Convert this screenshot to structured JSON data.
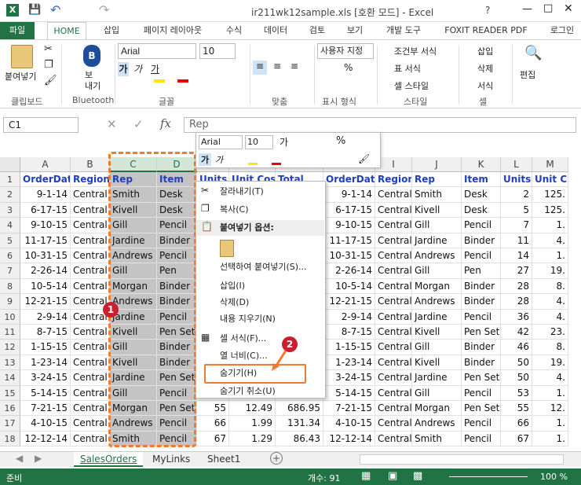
{
  "window": {
    "title": "ir211wk12sample.xls  [호환 모드] - Excel",
    "help": "?"
  },
  "tabs": [
    "파일",
    "HOME",
    "삽입",
    "페이지 레이아웃",
    "수식",
    "데이터",
    "검토",
    "보기",
    "개발 도구",
    "FOXIT READER PDF",
    "로그인"
  ],
  "ribbon": {
    "paste": "붙여넣기",
    "bluetooth": "보\n내기",
    "font_name": "Arial",
    "font_size": "10",
    "number_format": "사용자 지정",
    "cond_format": "조건부 서식",
    "table_format": "표 서식",
    "cell_style": "셀 스타일",
    "insert": "삽입",
    "delete": "삭제",
    "format": "서식",
    "edit": "편집",
    "groups": {
      "clipboard": "클립보드",
      "bluetooth": "Bluetooth",
      "font": "글꼴",
      "align": "맞춤",
      "number": "표시 형식",
      "style": "스타일",
      "cells": "셀"
    }
  },
  "formula": {
    "namebox": "C1",
    "value": "Rep",
    "fx": "fx"
  },
  "columns": [
    "A",
    "B",
    "C",
    "D",
    "E",
    "F",
    "G",
    "H",
    "I",
    "J",
    "K",
    "L",
    "M"
  ],
  "rows": [
    [
      "OrderDate",
      "Region",
      "Rep",
      "Item",
      "Units",
      "Unit Cost",
      "Total",
      "OrderDate",
      "Region",
      "Rep",
      "Item",
      "Units",
      "Unit C"
    ],
    [
      "9-1-14",
      "Central",
      "Smith",
      "Desk",
      "",
      "",
      "",
      "9-1-14",
      "Central",
      "Smith",
      "Desk",
      "2",
      "125."
    ],
    [
      "6-17-15",
      "Central",
      "Kivell",
      "Desk",
      "",
      "",
      "",
      "6-17-15",
      "Central",
      "Kivell",
      "Desk",
      "5",
      "125."
    ],
    [
      "9-10-15",
      "Central",
      "Gill",
      "Pencil",
      "",
      "",
      "",
      "9-10-15",
      "Central",
      "Gill",
      "Pencil",
      "7",
      "1."
    ],
    [
      "11-17-15",
      "Central",
      "Jardine",
      "Binder",
      "",
      "",
      "",
      "11-17-15",
      "Central",
      "Jardine",
      "Binder",
      "11",
      "4."
    ],
    [
      "10-31-15",
      "Central",
      "Andrews",
      "Pencil",
      "",
      "",
      "",
      "10-31-15",
      "Central",
      "Andrews",
      "Pencil",
      "14",
      "1."
    ],
    [
      "2-26-14",
      "Central",
      "Gill",
      "Pen",
      "",
      "",
      "",
      "2-26-14",
      "Central",
      "Gill",
      "Pen",
      "27",
      "19."
    ],
    [
      "10-5-14",
      "Central",
      "Morgan",
      "Binder",
      "",
      "",
      "",
      "10-5-14",
      "Central",
      "Morgan",
      "Binder",
      "28",
      "8."
    ],
    [
      "12-21-15",
      "Central",
      "Andrews",
      "Binder",
      "",
      "",
      "",
      "12-21-15",
      "Central",
      "Andrews",
      "Binder",
      "28",
      "4."
    ],
    [
      "2-9-14",
      "Central",
      "Jardine",
      "Pencil",
      "",
      "",
      "",
      "2-9-14",
      "Central",
      "Jardine",
      "Pencil",
      "36",
      "4."
    ],
    [
      "8-7-15",
      "Central",
      "Kivell",
      "Pen Set",
      "",
      "",
      "",
      "8-7-15",
      "Central",
      "Kivell",
      "Pen Set",
      "42",
      "23."
    ],
    [
      "1-15-15",
      "Central",
      "Gill",
      "Binder",
      "",
      "",
      "",
      "1-15-15",
      "Central",
      "Gill",
      "Binder",
      "46",
      "8."
    ],
    [
      "1-23-14",
      "Central",
      "Kivell",
      "Binder",
      "",
      "",
      "",
      "1-23-14",
      "Central",
      "Kivell",
      "Binder",
      "50",
      "19."
    ],
    [
      "3-24-15",
      "Central",
      "Jardine",
      "Pen Set",
      "",
      "",
      "",
      "3-24-15",
      "Central",
      "Jardine",
      "Pen Set",
      "50",
      "4."
    ],
    [
      "5-14-15",
      "Central",
      "Gill",
      "Pencil",
      "",
      "",
      "",
      "5-14-15",
      "Central",
      "Gill",
      "Pencil",
      "53",
      "1."
    ],
    [
      "7-21-15",
      "Central",
      "Morgan",
      "Pen Set",
      "55",
      "12.49",
      "686.95",
      "7-21-15",
      "Central",
      "Morgan",
      "Pen Set",
      "55",
      "12."
    ],
    [
      "4-10-15",
      "Central",
      "Andrews",
      "Pencil",
      "66",
      "1.99",
      "131.34",
      "4-10-15",
      "Central",
      "Andrews",
      "Pencil",
      "66",
      "1."
    ],
    [
      "12-12-14",
      "Central",
      "Smith",
      "Pencil",
      "67",
      "1.29",
      "86.43",
      "12-12-14",
      "Central",
      "Smith",
      "Pencil",
      "67",
      "1."
    ]
  ],
  "minitoolbar": {
    "font": "Arial",
    "size": "10"
  },
  "context_menu": {
    "cut": "잘라내기(T)",
    "copy": "복사(C)",
    "paste_options": "붙여넣기 옵션:",
    "paste_special": "선택하여 붙여넣기(S)...",
    "insert": "삽입(I)",
    "delete": "삭제(D)",
    "clear": "내용 지우기(N)",
    "format_cells": "셀 서식(F)...",
    "col_width": "열 너비(C)...",
    "hide": "숨기기(H)",
    "unhide": "숨기기 취소(U)"
  },
  "badges": {
    "one": "1",
    "two": "2"
  },
  "sheets": [
    "SalesOrders",
    "MyLinks",
    "Sheet1"
  ],
  "status": {
    "ready": "준비",
    "count": "개수: 91",
    "zoom": "100 %"
  },
  "colors": {
    "accent": "#217346",
    "highlight": "#ee7b30",
    "badge": "#c8202f"
  }
}
